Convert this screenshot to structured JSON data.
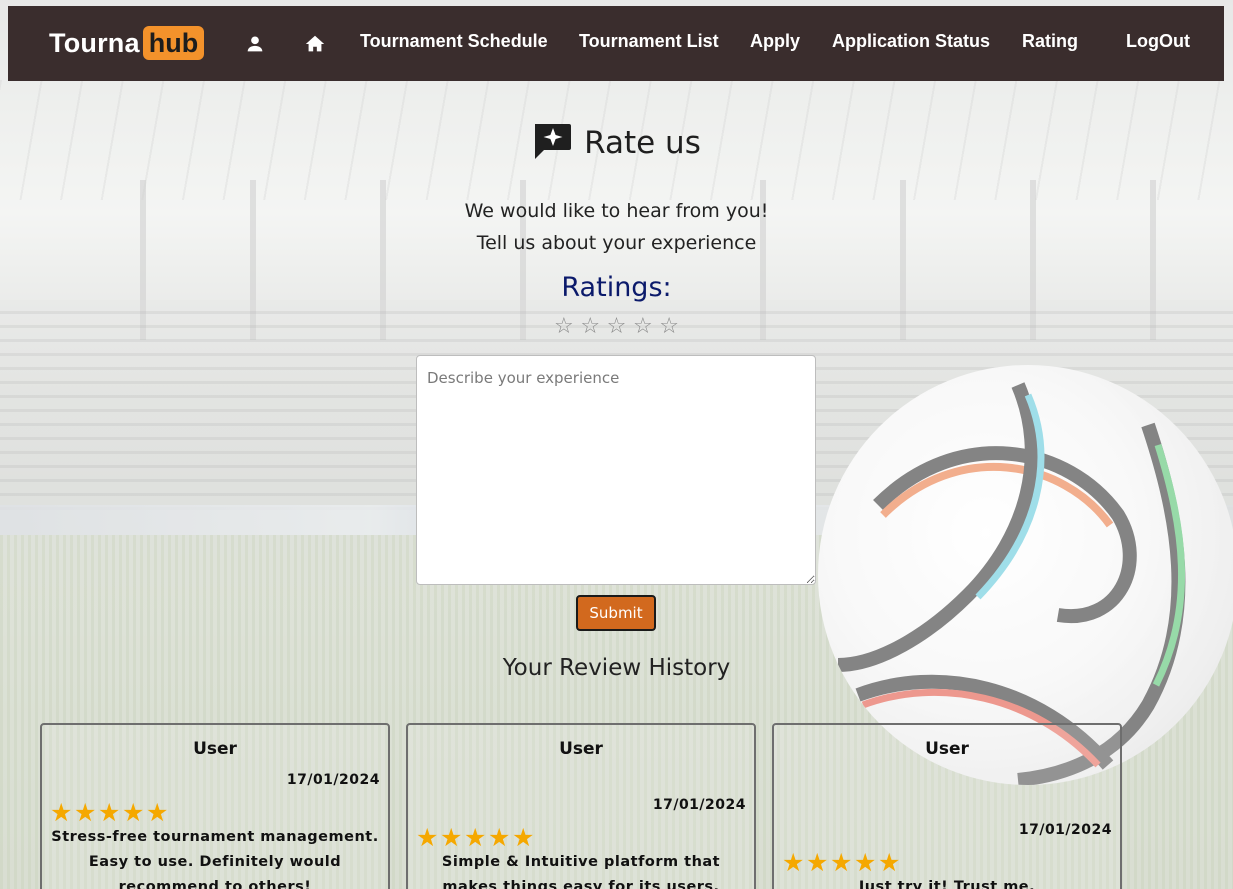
{
  "colors": {
    "nav_bg": "#3a2d2d",
    "brand_accent": "#f3922b",
    "ratings_label": "#0b1a6b",
    "submit_bg": "#d2691e",
    "star_filled": "#f5a800",
    "star_empty": "#8a8a8a"
  },
  "navbar": {
    "brand_part1": "Tourna",
    "brand_part2": "hub",
    "profile_icon": "person-icon",
    "home_icon": "home-icon",
    "links": [
      {
        "label": "Tournament Schedule"
      },
      {
        "label": "Tournament List"
      },
      {
        "label": "Apply"
      },
      {
        "label": "Application Status"
      },
      {
        "label": "Rating"
      },
      {
        "label": "LogOut"
      }
    ]
  },
  "rate": {
    "icon": "chat-star-icon",
    "title": "Rate us",
    "subtitle1": "We would like to hear from you!",
    "subtitle2": "Tell us about your experience",
    "ratings_label": "Ratings:",
    "star_glyph": "☆",
    "selected_rating": 0,
    "max_rating": 5,
    "textarea_placeholder": "Describe your experience",
    "submit_label": "Submit"
  },
  "history": {
    "title": "Your Review History",
    "reviews": [
      {
        "user": "User",
        "date": "17/01/2024",
        "rating": 5,
        "text": "Stress-free tournament management. Easy to use. Definitely would recommend to others!"
      },
      {
        "user": "User",
        "date": "17/01/2024",
        "rating": 5,
        "text": "Simple & Intuitive platform that makes things easy for its users."
      },
      {
        "user": "User",
        "date": "17/01/2024",
        "rating": 5,
        "text": "Just try it! Trust me."
      }
    ]
  }
}
